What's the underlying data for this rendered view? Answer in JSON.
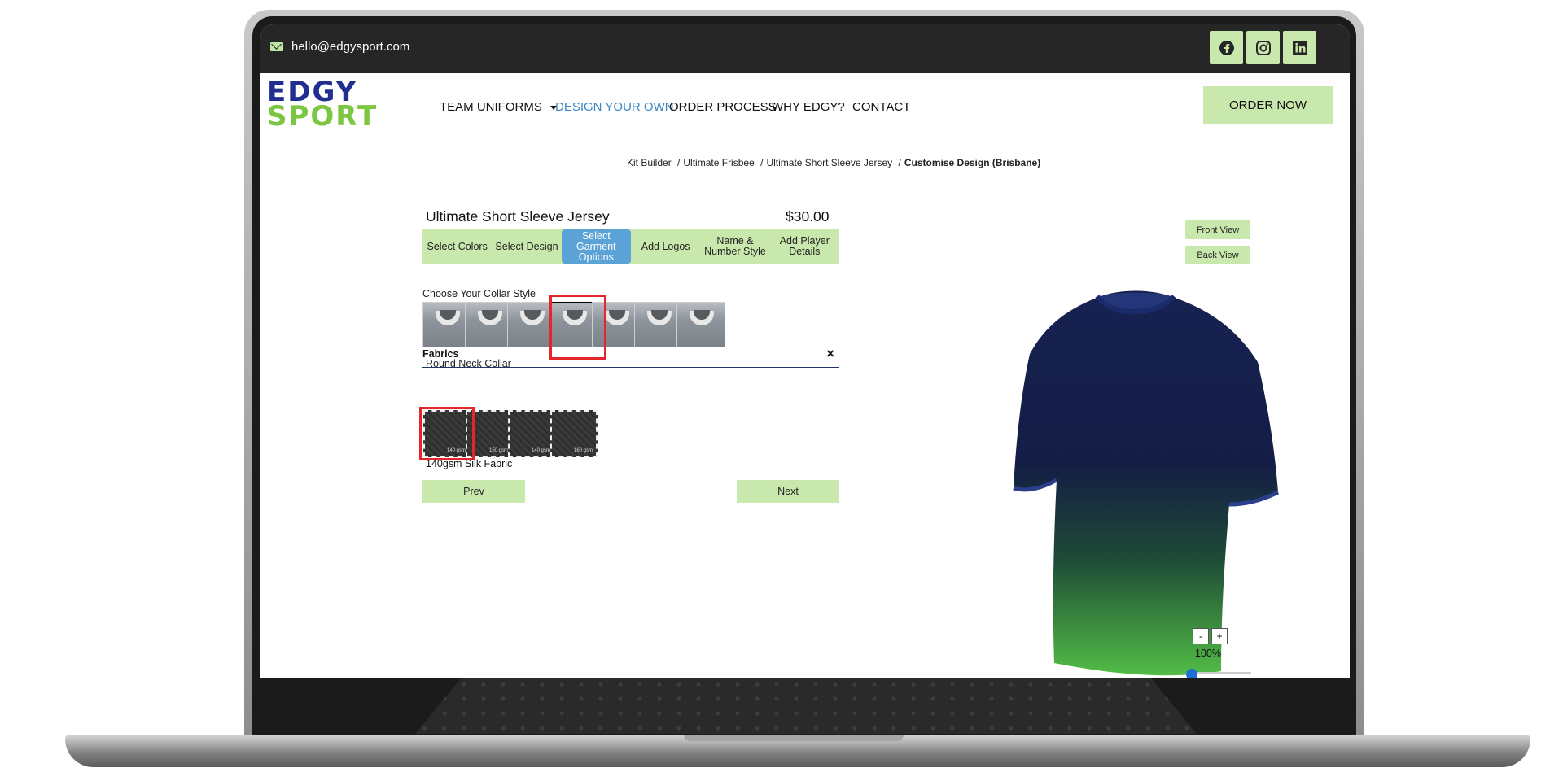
{
  "topbar": {
    "email": "hello@edgysport.com",
    "social": [
      "facebook-icon",
      "instagram-icon",
      "linkedin-icon"
    ]
  },
  "logo": {
    "line1": "EDGY",
    "line2": "SPORT"
  },
  "nav": {
    "items": [
      "TEAM UNIFORMS",
      "DESIGN YOUR OWN",
      "ORDER PROCESS",
      "WHY EDGY?",
      "CONTACT"
    ],
    "active": "DESIGN YOUR OWN",
    "order_now": "ORDER NOW"
  },
  "breadcrumb": {
    "items": [
      "Kit Builder",
      "Ultimate Frisbee",
      "Ultimate Short Sleeve Jersey"
    ],
    "current": "Customise Design (Brisbane)",
    "separator": "/"
  },
  "product": {
    "title": "Ultimate Short Sleeve Jersey",
    "price": "$30.00"
  },
  "steps": [
    "Select Colors",
    "Select Design",
    "Select Garment Options",
    "Add Logos",
    "Name & Number Style",
    "Add Player Details"
  ],
  "active_step": "Select Garment Options",
  "collar": {
    "heading": "Choose Your Collar Style",
    "selected_index": 3,
    "selected_label": "Round Neck Collar",
    "option_count": 7
  },
  "fabrics": {
    "heading": "Fabrics",
    "close": "×",
    "items": [
      {
        "badge": "140 gsm"
      },
      {
        "badge": "150 gsm"
      },
      {
        "badge": "140 gsm"
      },
      {
        "badge": "160 gsm"
      }
    ],
    "selected_index": 0,
    "selected_label": "140gsm Silk Fabric"
  },
  "buttons": {
    "prev": "Prev",
    "next": "Next",
    "front_view": "Front View",
    "back_view": "Back View"
  },
  "zoom": {
    "minus": "-",
    "plus": "+",
    "value": "100%",
    "level": 0.0
  },
  "colors": {
    "accent_green": "#c9e8ad",
    "accent_blue": "#5ba3d6",
    "nav_active": "#3c88c6",
    "topbar": "#262626",
    "shirt_top": "#172252",
    "shirt_bottom": "#49b044"
  }
}
